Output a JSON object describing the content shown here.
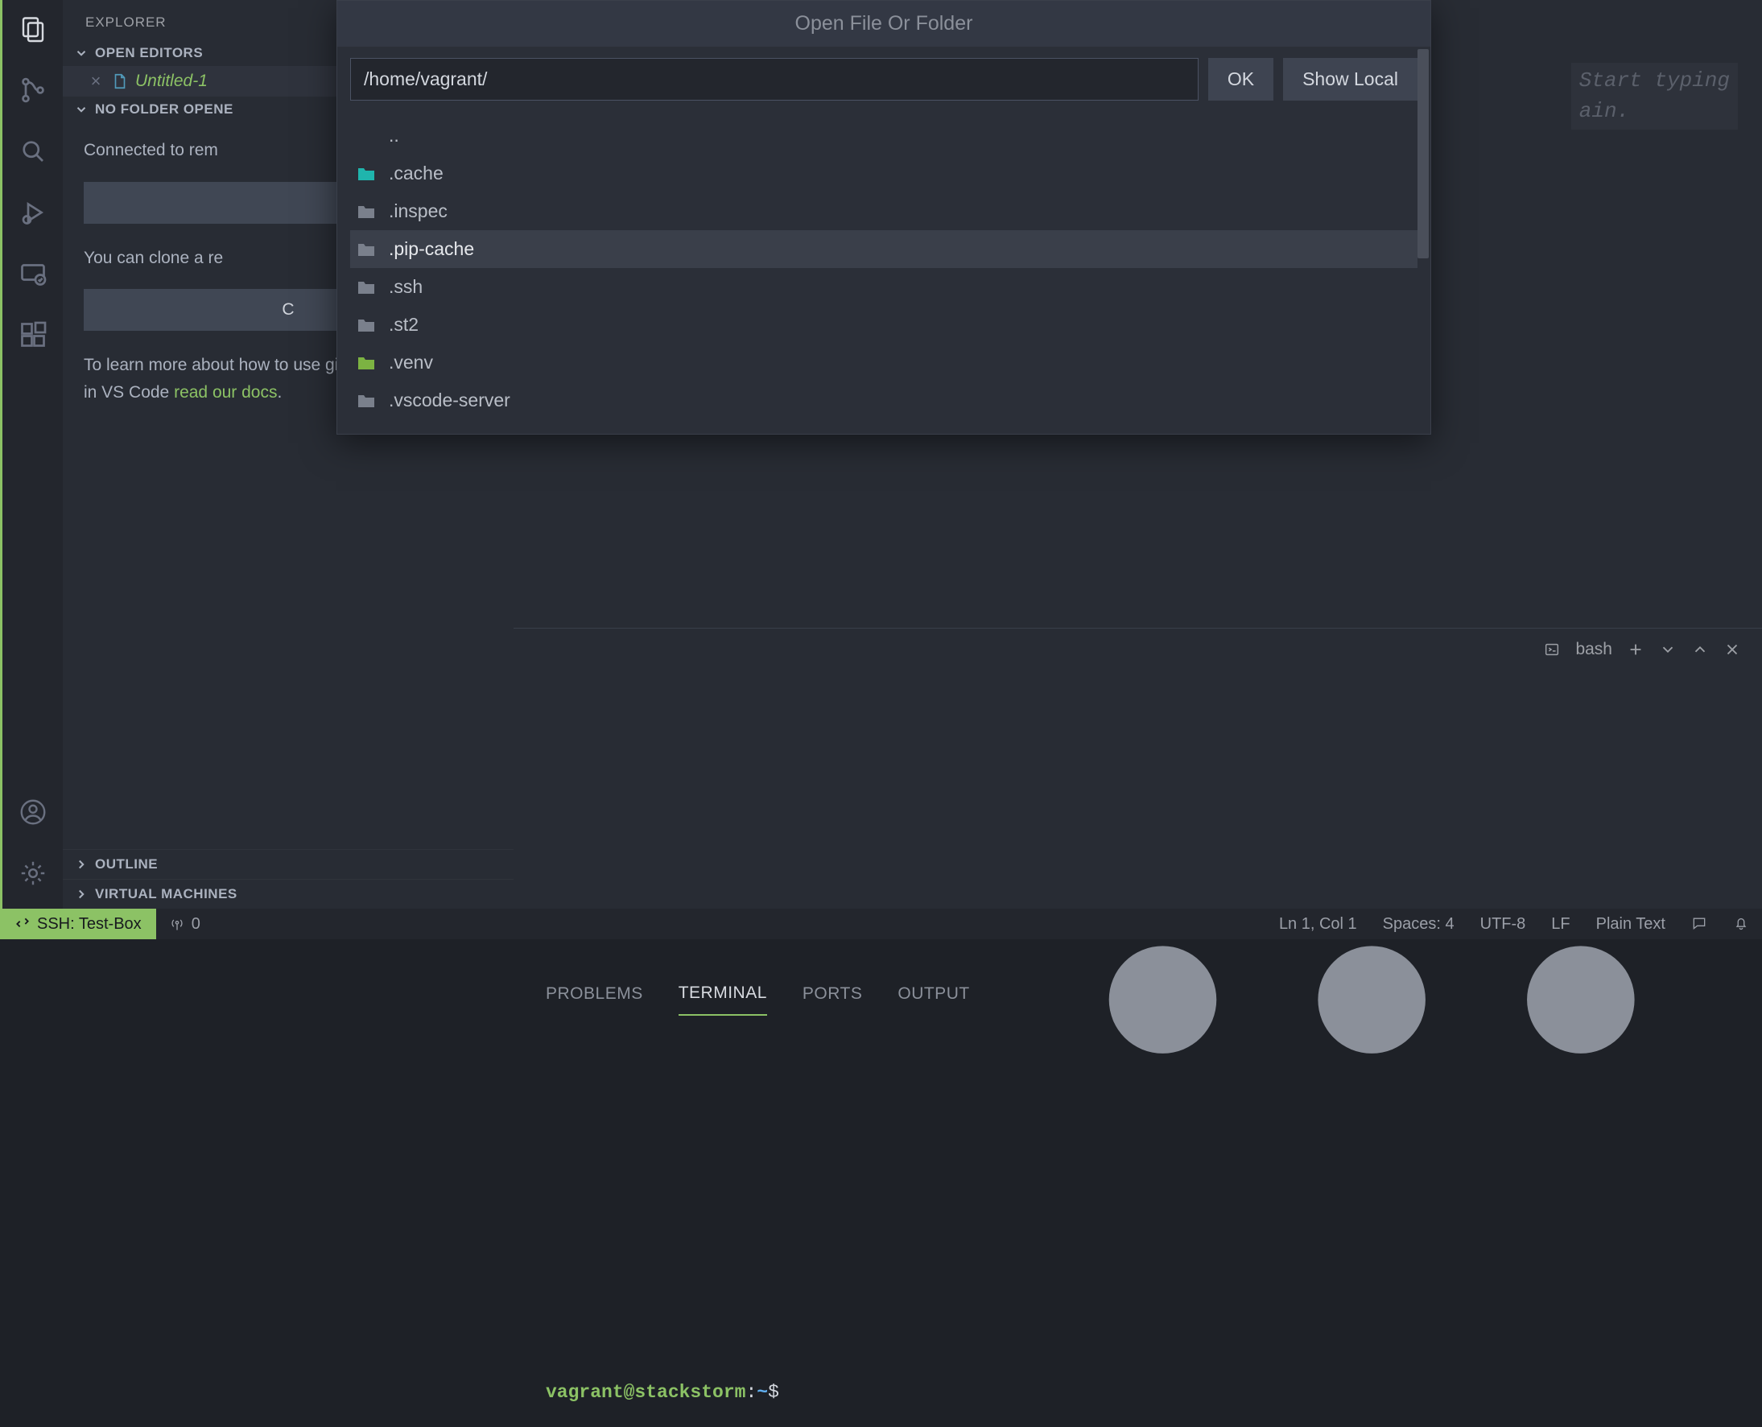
{
  "sidebar": {
    "title": "EXPLORER",
    "sections": {
      "open_editors": "OPEN EDITORS",
      "no_folder": "NO FOLDER OPENE",
      "outline": "OUTLINE",
      "virtual_machines": "VIRTUAL MACHINES"
    },
    "open_file": "Untitled-1",
    "connected_text": "Connected to rem",
    "clone_text": "You can clone a re",
    "clone_button_partial": "C",
    "learn_more_prefix": "To learn more about how to use git and source control in VS Code ",
    "learn_more_link": "read our docs",
    "learn_more_suffix": "."
  },
  "dialog": {
    "title": "Open File Or Folder",
    "input_value": "/home/vagrant/",
    "ok": "OK",
    "show_local": "Show Local",
    "items": [
      {
        "name": "..",
        "icon": "none"
      },
      {
        "name": ".cache",
        "icon": "teal"
      },
      {
        "name": ".inspec",
        "icon": "default"
      },
      {
        "name": ".pip-cache",
        "icon": "default",
        "hover": true
      },
      {
        "name": ".ssh",
        "icon": "default"
      },
      {
        "name": ".st2",
        "icon": "default"
      },
      {
        "name": ".venv",
        "icon": "green"
      },
      {
        "name": ".vscode-server",
        "icon": "default"
      }
    ]
  },
  "editor": {
    "hint_line1": "Start typing",
    "hint_line2": "ain."
  },
  "panel": {
    "tabs": {
      "problems": "PROBLEMS",
      "terminal": "TERMINAL",
      "ports": "PORTS",
      "output": "OUTPUT"
    },
    "shell_label": "bash",
    "prompt_user": "vagrant@stackstorm",
    "prompt_colon": ":",
    "prompt_path": "~",
    "prompt_dollar": "$"
  },
  "status": {
    "remote": "SSH: Test-Box",
    "radio_count": "0",
    "cursor": "Ln 1, Col 1",
    "spaces": "Spaces: 4",
    "encoding": "UTF-8",
    "eol": "LF",
    "lang": "Plain Text"
  }
}
